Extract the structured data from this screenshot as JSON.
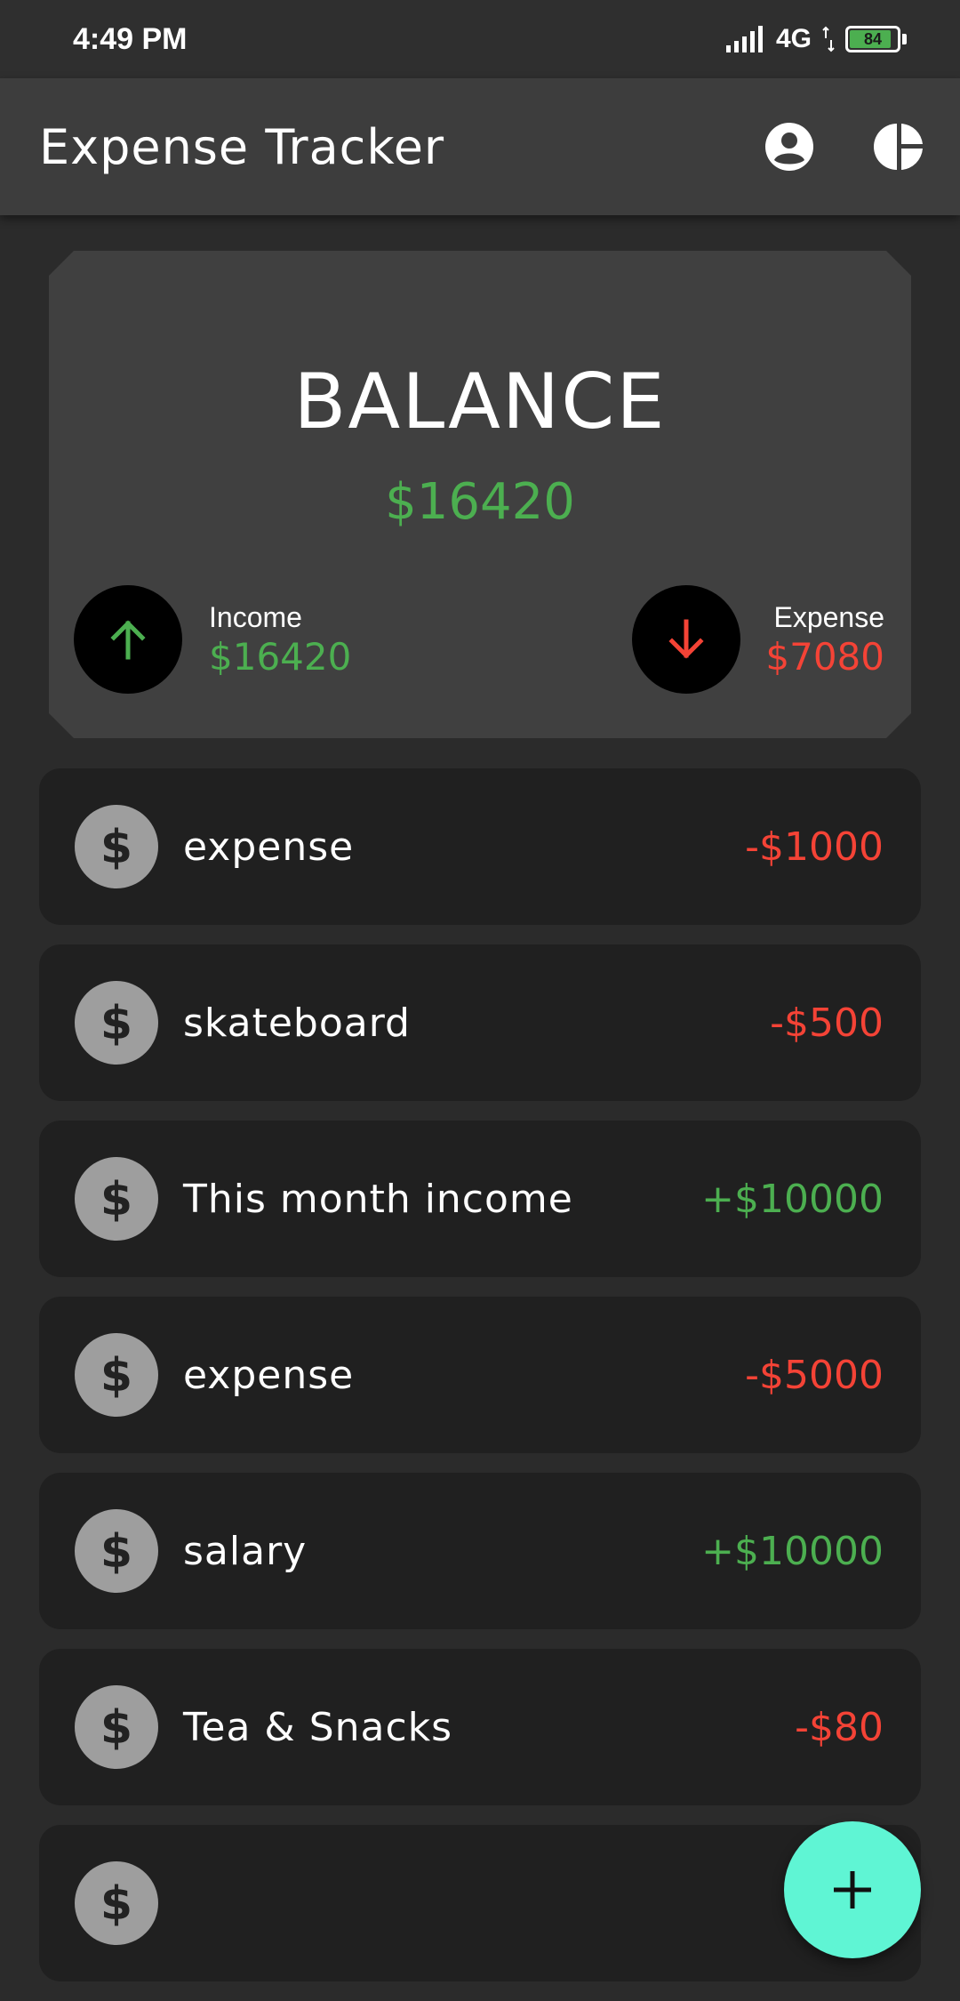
{
  "status_bar": {
    "time": "4:49 PM",
    "network": "4G",
    "battery": "84"
  },
  "app_bar": {
    "title": "Expense Tracker",
    "icons": [
      "account-circle-icon",
      "pie-chart-icon"
    ]
  },
  "balance": {
    "title": "BALANCE",
    "amount": "$16420",
    "income_label": "Income",
    "income_value": "$16420",
    "expense_label": "Expense",
    "expense_value": "$7080"
  },
  "transactions": [
    {
      "name": "expense",
      "amount": "-$1000",
      "type": "expense"
    },
    {
      "name": "skateboard",
      "amount": "-$500",
      "type": "expense"
    },
    {
      "name": "This month income",
      "amount": "+$10000",
      "type": "income"
    },
    {
      "name": "expense",
      "amount": "-$5000",
      "type": "expense"
    },
    {
      "name": "salary",
      "amount": "+$10000",
      "type": "income"
    },
    {
      "name": "Tea & Snacks",
      "amount": "-$80",
      "type": "expense"
    },
    {
      "name": "",
      "amount": "+$",
      "type": "income"
    }
  ],
  "colors": {
    "income": "#4caf50",
    "expense": "#f44336",
    "fab": "#5ff5d4",
    "background": "#2b2b2b"
  }
}
